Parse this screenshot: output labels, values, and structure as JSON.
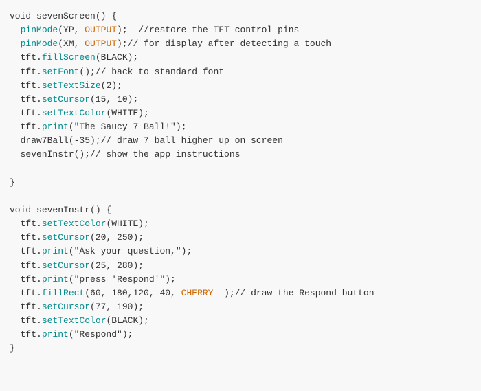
{
  "code": {
    "lines": [
      {
        "id": 1,
        "parts": [
          {
            "text": "void ",
            "color": "default"
          },
          {
            "text": "sevenScreen",
            "color": "black"
          },
          {
            "text": "() {",
            "color": "default"
          }
        ]
      },
      {
        "id": 2,
        "parts": [
          {
            "text": "  ",
            "color": "default"
          },
          {
            "text": "pinMode",
            "color": "teal"
          },
          {
            "text": "(YP, ",
            "color": "default"
          },
          {
            "text": "OUTPUT",
            "color": "orange"
          },
          {
            "text": ");  //restore the TFT control pins",
            "color": "default"
          }
        ]
      },
      {
        "id": 3,
        "parts": [
          {
            "text": "  ",
            "color": "default"
          },
          {
            "text": "pinMode",
            "color": "teal"
          },
          {
            "text": "(XM, ",
            "color": "default"
          },
          {
            "text": "OUTPUT",
            "color": "orange"
          },
          {
            "text": ");//  for display after detecting a touch",
            "color": "default"
          }
        ]
      },
      {
        "id": 4,
        "parts": [
          {
            "text": "  tft.",
            "color": "default"
          },
          {
            "text": "fillScreen",
            "color": "teal"
          },
          {
            "text": "(BLACK);",
            "color": "default"
          }
        ]
      },
      {
        "id": 5,
        "parts": [
          {
            "text": "  tft.",
            "color": "default"
          },
          {
            "text": "setFont",
            "color": "teal"
          },
          {
            "text": "();// back to standard font",
            "color": "default"
          }
        ]
      },
      {
        "id": 6,
        "parts": [
          {
            "text": "  tft.",
            "color": "default"
          },
          {
            "text": "setTextSize",
            "color": "teal"
          },
          {
            "text": "(2);",
            "color": "default"
          }
        ]
      },
      {
        "id": 7,
        "parts": [
          {
            "text": "  tft.",
            "color": "default"
          },
          {
            "text": "setCursor",
            "color": "teal"
          },
          {
            "text": "(15, 10);",
            "color": "default"
          }
        ]
      },
      {
        "id": 8,
        "parts": [
          {
            "text": "  tft.",
            "color": "default"
          },
          {
            "text": "setTextColor",
            "color": "teal"
          },
          {
            "text": "(WHITE);",
            "color": "default"
          }
        ]
      },
      {
        "id": 9,
        "parts": [
          {
            "text": "  tft.",
            "color": "default"
          },
          {
            "text": "print",
            "color": "teal"
          },
          {
            "text": "(\"The Saucy 7 Ball!\");",
            "color": "default"
          }
        ]
      },
      {
        "id": 10,
        "parts": [
          {
            "text": "  draw7Ball(-35);// draw 7 ball higher up on screen",
            "color": "default"
          }
        ]
      },
      {
        "id": 11,
        "parts": [
          {
            "text": "  sevenInstr();// show the app instructions",
            "color": "default"
          }
        ]
      },
      {
        "id": 12,
        "parts": [
          {
            "text": "",
            "color": "default"
          }
        ]
      },
      {
        "id": 13,
        "parts": [
          {
            "text": "}",
            "color": "default"
          }
        ]
      },
      {
        "id": 14,
        "parts": [
          {
            "text": "",
            "color": "default"
          }
        ]
      },
      {
        "id": 15,
        "parts": [
          {
            "text": "void ",
            "color": "default"
          },
          {
            "text": "sevenInstr",
            "color": "black"
          },
          {
            "text": "() {",
            "color": "default"
          }
        ]
      },
      {
        "id": 16,
        "parts": [
          {
            "text": "  tft.",
            "color": "default"
          },
          {
            "text": "setTextColor",
            "color": "teal"
          },
          {
            "text": "(WHITE);",
            "color": "default"
          }
        ]
      },
      {
        "id": 17,
        "parts": [
          {
            "text": "  tft.",
            "color": "default"
          },
          {
            "text": "setCursor",
            "color": "teal"
          },
          {
            "text": "(20, 250);",
            "color": "default"
          }
        ]
      },
      {
        "id": 18,
        "parts": [
          {
            "text": "  tft.",
            "color": "default"
          },
          {
            "text": "print",
            "color": "teal"
          },
          {
            "text": "(\"Ask your question,\");",
            "color": "default"
          }
        ]
      },
      {
        "id": 19,
        "parts": [
          {
            "text": "  tft.",
            "color": "default"
          },
          {
            "text": "setCursor",
            "color": "teal"
          },
          {
            "text": "(25, 280);",
            "color": "default"
          }
        ]
      },
      {
        "id": 20,
        "parts": [
          {
            "text": "  tft.",
            "color": "default"
          },
          {
            "text": "print",
            "color": "teal"
          },
          {
            "text": "(\"press 'Respond'\");",
            "color": "default"
          }
        ]
      },
      {
        "id": 21,
        "parts": [
          {
            "text": "  tft.",
            "color": "default"
          },
          {
            "text": "fillRect",
            "color": "teal"
          },
          {
            "text": "(60, 180,120, 40, ",
            "color": "default"
          },
          {
            "text": "CHERRY",
            "color": "orange"
          },
          {
            "text": "  );// draw the Respond button",
            "color": "default"
          }
        ]
      },
      {
        "id": 22,
        "parts": [
          {
            "text": "  tft.",
            "color": "default"
          },
          {
            "text": "setCursor",
            "color": "teal"
          },
          {
            "text": "(77, 190);",
            "color": "default"
          }
        ]
      },
      {
        "id": 23,
        "parts": [
          {
            "text": "  tft.",
            "color": "default"
          },
          {
            "text": "setTextColor",
            "color": "teal"
          },
          {
            "text": "(BLACK);",
            "color": "default"
          }
        ]
      },
      {
        "id": 24,
        "parts": [
          {
            "text": "  tft.",
            "color": "default"
          },
          {
            "text": "print",
            "color": "teal"
          },
          {
            "text": "(\"Respond\");",
            "color": "default"
          }
        ]
      },
      {
        "id": 25,
        "parts": [
          {
            "text": "}",
            "color": "default"
          }
        ]
      }
    ]
  }
}
